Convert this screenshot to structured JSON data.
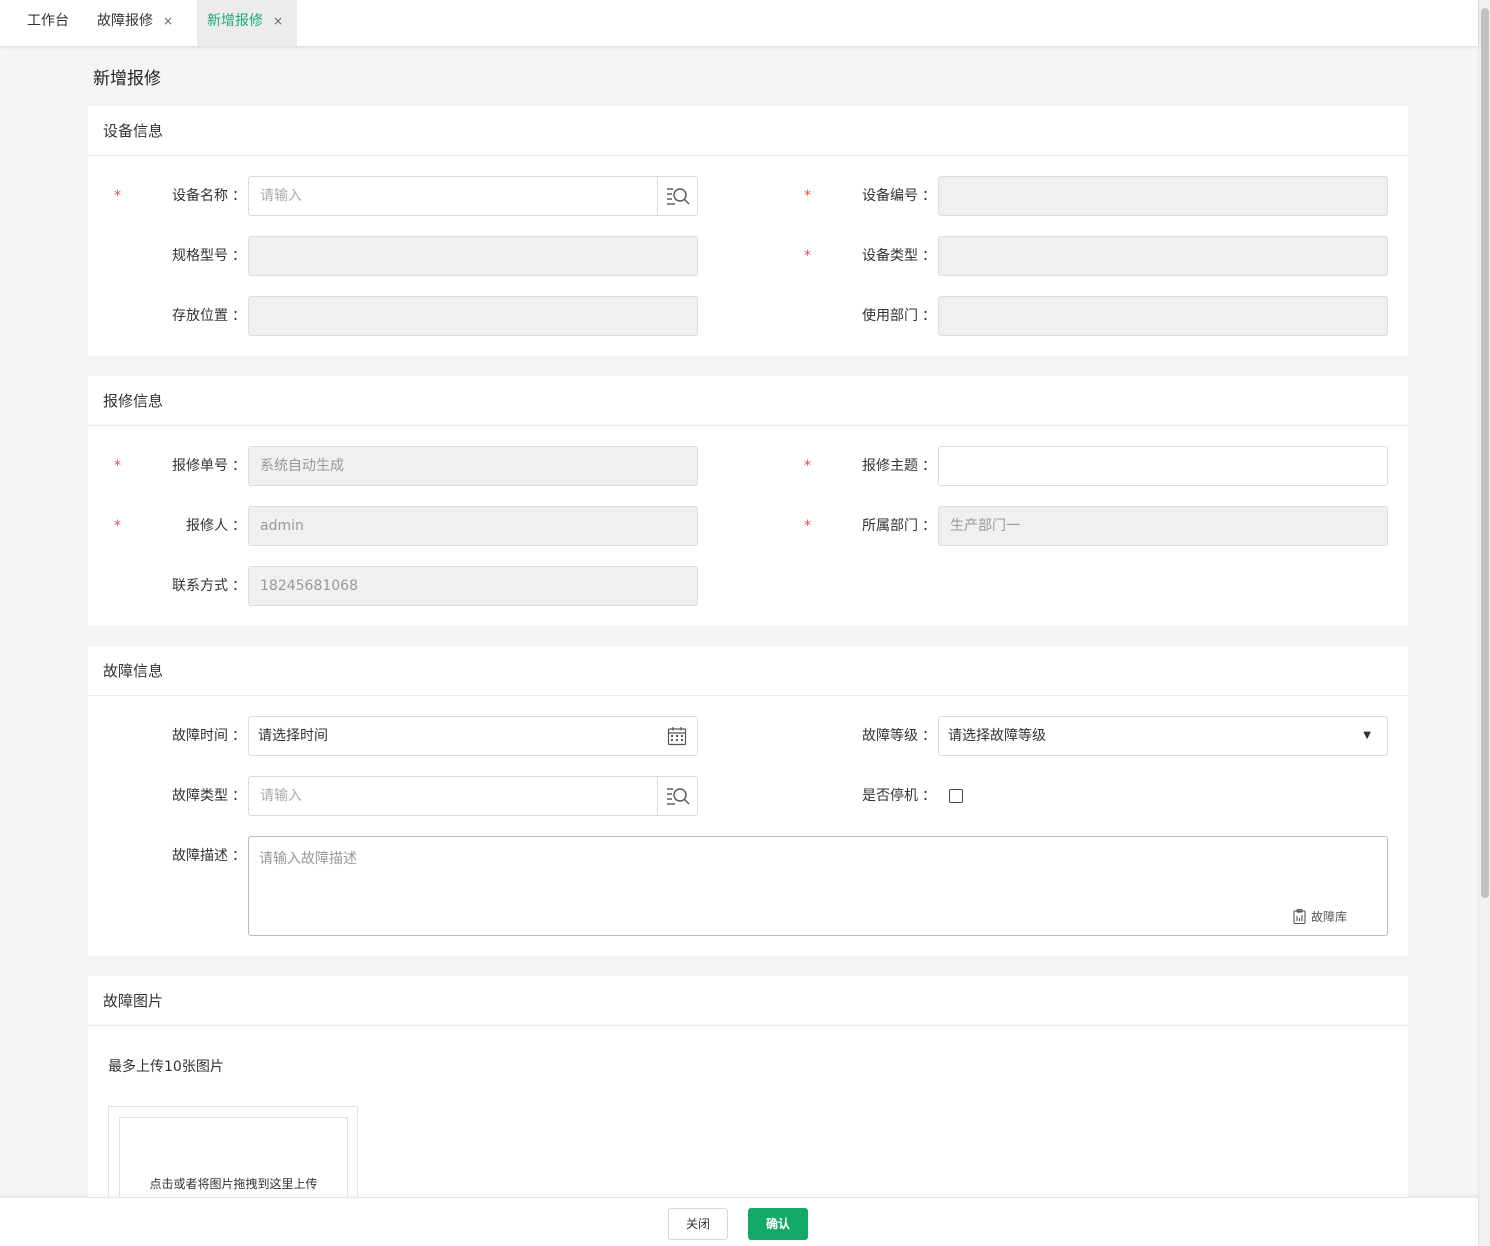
{
  "tabs": [
    {
      "label": "工作台",
      "closable": false,
      "active": false
    },
    {
      "label": "故障报修",
      "closable": true,
      "active": false
    },
    {
      "label": "新增报修",
      "closable": true,
      "active": true
    }
  ],
  "tab_close_glyph": "×",
  "colon": "：",
  "page_title": "新增报修",
  "device_section": {
    "title": "设备信息",
    "device_name": {
      "label": "设备名称",
      "placeholder": "请输入",
      "required": true
    },
    "device_code": {
      "label": "设备编号",
      "required": true
    },
    "spec_model": {
      "label": "规格型号",
      "required": false
    },
    "device_type": {
      "label": "设备类型",
      "required": true
    },
    "location": {
      "label": "存放位置",
      "required": false
    },
    "department": {
      "label": "使用部门",
      "required": false
    }
  },
  "repair_section": {
    "title": "报修信息",
    "order_no": {
      "label": "报修单号",
      "value": "系统自动生成",
      "required": true
    },
    "subject": {
      "label": "报修主题",
      "value": "",
      "required": true
    },
    "reporter": {
      "label": "报修人",
      "value": "admin",
      "required": true
    },
    "dept": {
      "label": "所属部门",
      "value": "生产部门一",
      "required": true
    },
    "contact": {
      "label": "联系方式",
      "value": "18245681068",
      "required": false
    }
  },
  "fault_section": {
    "title": "故障信息",
    "fault_time": {
      "label": "故障时间",
      "placeholder": "请选择时间"
    },
    "fault_level": {
      "label": "故障等级",
      "selected": "请选择故障等级"
    },
    "fault_type": {
      "label": "故障类型",
      "placeholder": "请输入"
    },
    "is_shutdown": {
      "label": "是否停机",
      "checked": false
    },
    "description": {
      "label": "故障描述",
      "placeholder": "请输入故障描述",
      "library_label": "故障库"
    }
  },
  "image_section": {
    "title": "故障图片",
    "note": "最多上传10张图片",
    "upload_hint": "点击或者将图片拖拽到这里上传"
  },
  "required_mark": "*",
  "footer": {
    "close_label": "关闭",
    "confirm_label": "确认"
  },
  "colors": {
    "accent": "#14a867",
    "active_tab_text": "#1aad6f",
    "required": "#e94b4b"
  },
  "icons": [
    "search-list-icon",
    "calendar-icon",
    "library-icon",
    "caret-down-icon",
    "close-icon"
  ]
}
